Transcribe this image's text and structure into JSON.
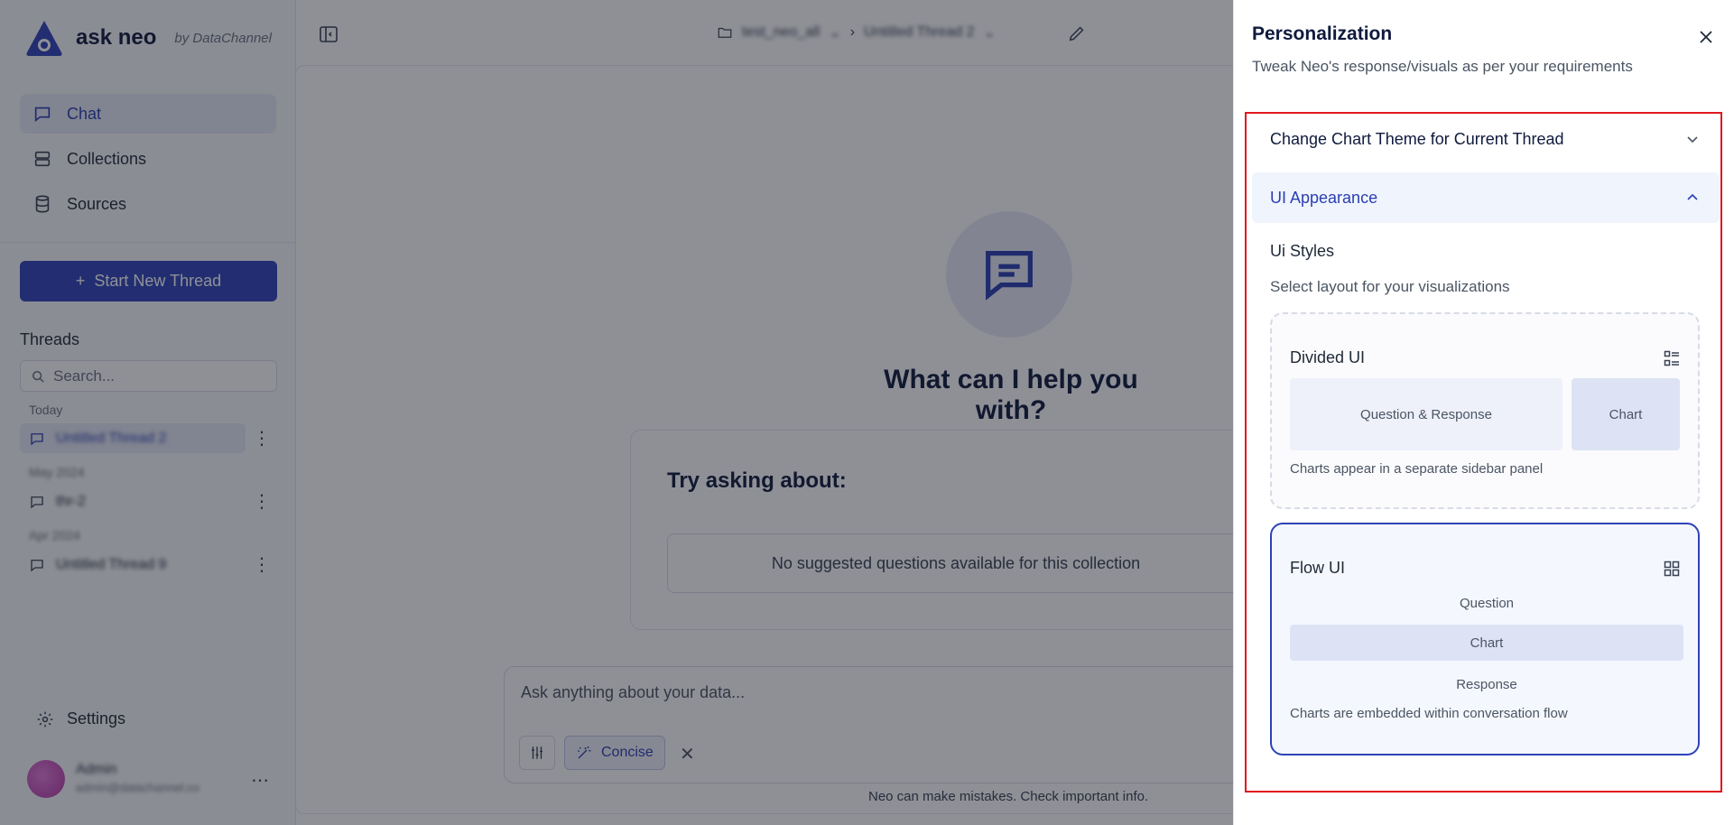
{
  "brand": {
    "name": "ask neo",
    "by": "by DataChannel"
  },
  "nav": {
    "chat": "Chat",
    "collections": "Collections",
    "sources": "Sources"
  },
  "new_thread_label": "Start New Thread",
  "threads": {
    "title": "Threads",
    "search_placeholder": "Search...",
    "groups": [
      {
        "label": "Today",
        "items": [
          {
            "title": "Untitled Thread 2"
          }
        ]
      },
      {
        "label": "May 2024",
        "items": [
          {
            "title": "thr-2"
          }
        ]
      },
      {
        "label": "Apr 2024",
        "items": [
          {
            "title": "Untitled Thread 9"
          }
        ]
      }
    ]
  },
  "settings_label": "Settings",
  "user": {
    "name": "Admin",
    "email": "admin@datachannel.co"
  },
  "header": {
    "collection": "test_neo_all",
    "thread": "Untitled Thread 2"
  },
  "main": {
    "hero_title": "What can I help you with?",
    "try_title": "Try asking about:",
    "no_questions": "No suggested questions available for this collection",
    "composer_placeholder": "Ask anything about your data...",
    "concise_label": "Concise",
    "disclaimer": "Neo can make mistakes. Check important info."
  },
  "panel": {
    "title": "Personalization",
    "subtitle": "Tweak Neo's response/visuals as per your requirements",
    "accordions": {
      "chart_theme": "Change Chart Theme for Current Thread",
      "ui_appearance": "UI Appearance"
    },
    "ui_styles_title": "Ui Styles",
    "ui_styles_sub": "Select layout for your visualizations",
    "options": {
      "divided": {
        "name": "Divided UI",
        "left": "Question & Response",
        "right": "Chart",
        "desc": "Charts appear in a separate sidebar panel"
      },
      "flow": {
        "name": "Flow UI",
        "question": "Question",
        "chart": "Chart",
        "response": "Response",
        "desc": "Charts are embedded within conversation flow"
      }
    },
    "selected_option": "Flow UI"
  },
  "colors": {
    "accent": "#2e43b8",
    "highlight": "#e0191f",
    "overlay": "rgba(20,24,36,0.48)"
  }
}
